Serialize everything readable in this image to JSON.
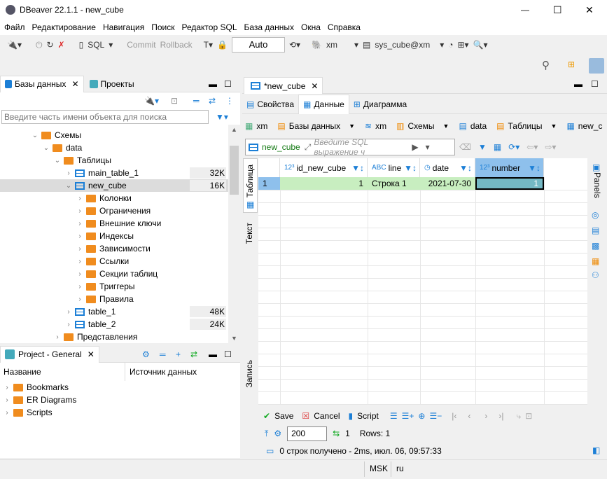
{
  "window": {
    "title": "DBeaver 22.1.1 - new_cube",
    "min": "—",
    "max": "☐",
    "close": "✕"
  },
  "menu": [
    "Файл",
    "Редактирование",
    "Навигация",
    "Поиск",
    "Редактор SQL",
    "База данных",
    "Окна",
    "Справка"
  ],
  "toolbar": {
    "sql": "SQL",
    "commit": "Commit",
    "rollback": "Rollback",
    "mode": "Auto",
    "datasource": "xm",
    "schema": "sys_cube@xm"
  },
  "left": {
    "tabs": [
      "Базы данных",
      "Проекты"
    ],
    "search_placeholder": "Введите часть имени объекта для поиска",
    "tree": [
      {
        "label": "Схемы",
        "level": 3,
        "icon": "schemas",
        "open": true
      },
      {
        "label": "data",
        "level": 4,
        "icon": "schema",
        "open": true
      },
      {
        "label": "Таблицы",
        "level": 5,
        "icon": "tables",
        "open": true
      },
      {
        "label": "main_table_1",
        "level": 6,
        "icon": "table",
        "size": "32K"
      },
      {
        "label": "new_cube",
        "level": 6,
        "icon": "table",
        "size": "16K",
        "open": true,
        "selected": true
      },
      {
        "label": "Колонки",
        "level": 7,
        "icon": "folder"
      },
      {
        "label": "Ограничения",
        "level": 7,
        "icon": "folder"
      },
      {
        "label": "Внешние ключи",
        "level": 7,
        "icon": "folder"
      },
      {
        "label": "Индексы",
        "level": 7,
        "icon": "folder"
      },
      {
        "label": "Зависимости",
        "level": 7,
        "icon": "folder"
      },
      {
        "label": "Ссылки",
        "level": 7,
        "icon": "folder"
      },
      {
        "label": "Секции таблиц",
        "level": 7,
        "icon": "folder"
      },
      {
        "label": "Триггеры",
        "level": 7,
        "icon": "folder"
      },
      {
        "label": "Правила",
        "level": 7,
        "icon": "folder"
      },
      {
        "label": "table_1",
        "level": 6,
        "icon": "table",
        "size": "48K"
      },
      {
        "label": "table_2",
        "level": 6,
        "icon": "table",
        "size": "24K"
      },
      {
        "label": "Представления",
        "level": 5,
        "icon": "views"
      }
    ]
  },
  "project": {
    "tab": "Project - General",
    "columns": [
      "Название",
      "Источник данных"
    ],
    "items": [
      "Bookmarks",
      "ER Diagrams",
      "Scripts"
    ]
  },
  "editor": {
    "tab": "*new_cube",
    "subtabs": [
      "Свойства",
      "Данные",
      "Диаграмма"
    ],
    "breadcrumbs": [
      "xm",
      "Базы данных",
      "xm",
      "Схемы",
      "data",
      "Таблицы",
      "new_c"
    ],
    "table_name": "new_cube",
    "filter_placeholder": "Введите SQL выражение ч",
    "side_tabs": [
      "Таблица",
      "Текст",
      "Запись"
    ],
    "panels_label": "Panels",
    "columns": [
      {
        "name": "id_new_cube",
        "type": "123"
      },
      {
        "name": "line",
        "type": "ABC"
      },
      {
        "name": "date",
        "type": "clock"
      },
      {
        "name": "number",
        "type": "123"
      }
    ],
    "rows": [
      {
        "num": "1",
        "cells": [
          "1",
          "Строка 1",
          "2021-07-30",
          "1"
        ]
      }
    ],
    "save": "Save",
    "cancel": "Cancel",
    "script": "Script",
    "fetch_size": "200",
    "refresh_count": "1",
    "rows_label": "Rows: 1",
    "status": "0 строк получено - 2ms, июл. 06, 09:57:33"
  },
  "statusbar": {
    "tz": "MSK",
    "locale": "ru"
  }
}
